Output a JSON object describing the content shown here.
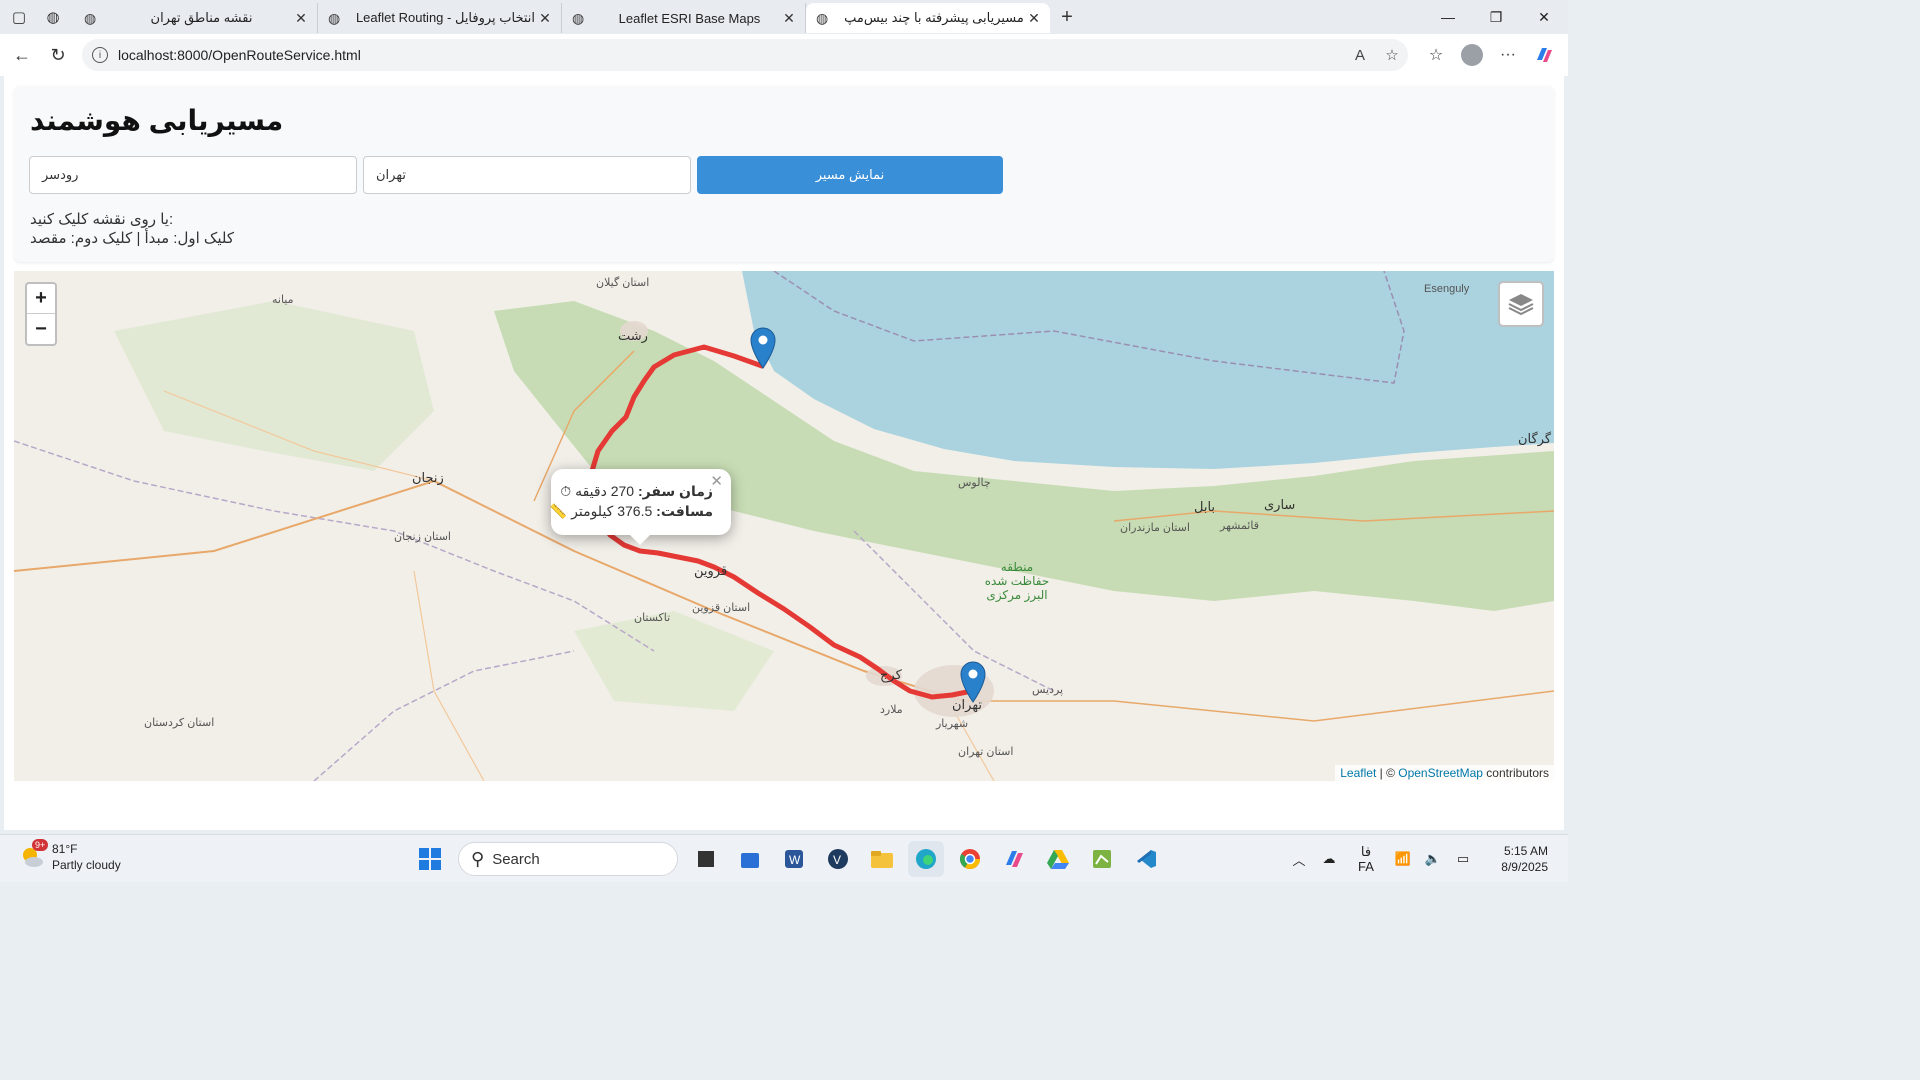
{
  "browser": {
    "tabs": [
      {
        "label": "نقشه مناطق تهران",
        "active": false
      },
      {
        "label": "Leaflet Routing - انتخاب پروفایل",
        "active": false
      },
      {
        "label": "Leaflet ESRI Base Maps",
        "active": false
      },
      {
        "label": "مسیریابی پیشرفته با چند بیس‌مپ",
        "active": true
      }
    ],
    "url": "localhost:8000/OpenRouteService.html"
  },
  "page": {
    "title": "مسیریابی هوشمند",
    "origin_value": "رودسر",
    "destination_value": "تهران",
    "route_button": "نمایش مسیر",
    "hint_line1": "یا روی نقشه کلیک کنید:",
    "hint_line2": "کلیک اول: مبدأ | کلیک دوم: مقصد"
  },
  "map": {
    "zoom_in": "+",
    "zoom_out": "−",
    "route_color": "#e53935",
    "water_color": "#aad3df",
    "popup": {
      "time_label": "زمان سفر:",
      "time_value": "270 دقیقه",
      "distance_label": "مسافت:",
      "distance_value": "376.5 کیلومتر"
    },
    "attribution": {
      "leaflet": "Leaflet",
      "sep": " | © ",
      "osm": "OpenStreetMap",
      "contrib": " contributors"
    },
    "labels": {
      "gilan": "استان گیلان",
      "rasht": "رشت",
      "zanjan": "زنجان",
      "zanjan_prov": "استان زنجان",
      "qazvin": "قزوین",
      "qazvin_prov": "استان قزوین",
      "takestan": "تاکستان",
      "karaj": "کرج",
      "tehran": "تهران",
      "shahriar": "شهریار",
      "malard": "ملارد",
      "pardis": "پردیس",
      "tehran_prov": "استان تهران",
      "chalus": "چالوس",
      "babol": "بابل",
      "sari": "ساری",
      "gorgan": "گرگان",
      "mazandaran": "استان مازندران",
      "qaemshahr": "قائمشهر",
      "kordestan": "استان کردستان",
      "alborz_park": "منطقه حفاظت شده البرز مرکزی",
      "esenguly": "Esenguly",
      "mianeh": "میانه"
    }
  },
  "taskbar": {
    "temp": "81°F",
    "condition": "Partly cloudy",
    "badge": "9+",
    "search": "Search",
    "lang1": "فا",
    "lang2": "FA",
    "time": "5:15 AM",
    "date": "8/9/2025"
  }
}
